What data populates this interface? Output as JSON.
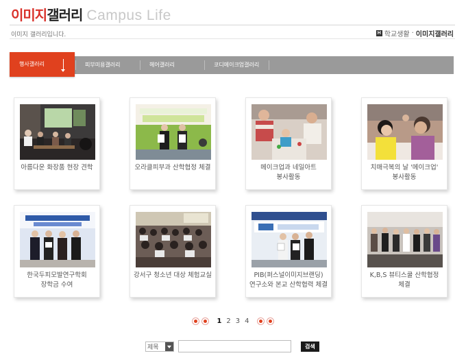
{
  "header": {
    "title_red": "이미지",
    "title_dark": "갤러리",
    "title_en": "Campus Life",
    "subtitle": "이미지 갤러리입니다.",
    "home_icon": "H",
    "breadcrumb_1": "학교생활",
    "breadcrumb_sep": "·",
    "breadcrumb_2": "이미지갤러리"
  },
  "tabs": [
    "행사갤러리",
    "피부미용갤러리",
    "헤어갤러리",
    "코디메이크업갤러리"
  ],
  "accent_color": "#e0411e",
  "gallery": [
    {
      "caption": "아름다운 화장품 현장 견학",
      "icon": "classroom-photo"
    },
    {
      "caption": "오라클피부과 산학협정 체결",
      "icon": "ceremony-photo"
    },
    {
      "caption": "메이크업과 네일아트 봉사활동",
      "icon": "volunteer-photo"
    },
    {
      "caption": "치매극복의 날 '메이크업' 봉사활동",
      "icon": "makeup-service-photo"
    },
    {
      "caption": "한국두피모발연구학회 장학금 수여",
      "icon": "scholarship-photo"
    },
    {
      "caption": "강서구 청소년 대상 체험교실",
      "icon": "experience-class-photo"
    },
    {
      "caption": "PIB(퍼스널이미지브랜딩) 연구소와 본교 산학협력 체결",
      "icon": "agreement-photo"
    },
    {
      "caption": "K,B,S 뷰티스쿨 산학협정 체결",
      "icon": "group-photo"
    }
  ],
  "pagination": {
    "pages": [
      "1",
      "2",
      "3",
      "4"
    ],
    "current": "1"
  },
  "search": {
    "select_value": "제목",
    "input_value": "",
    "button_label": "검색"
  }
}
